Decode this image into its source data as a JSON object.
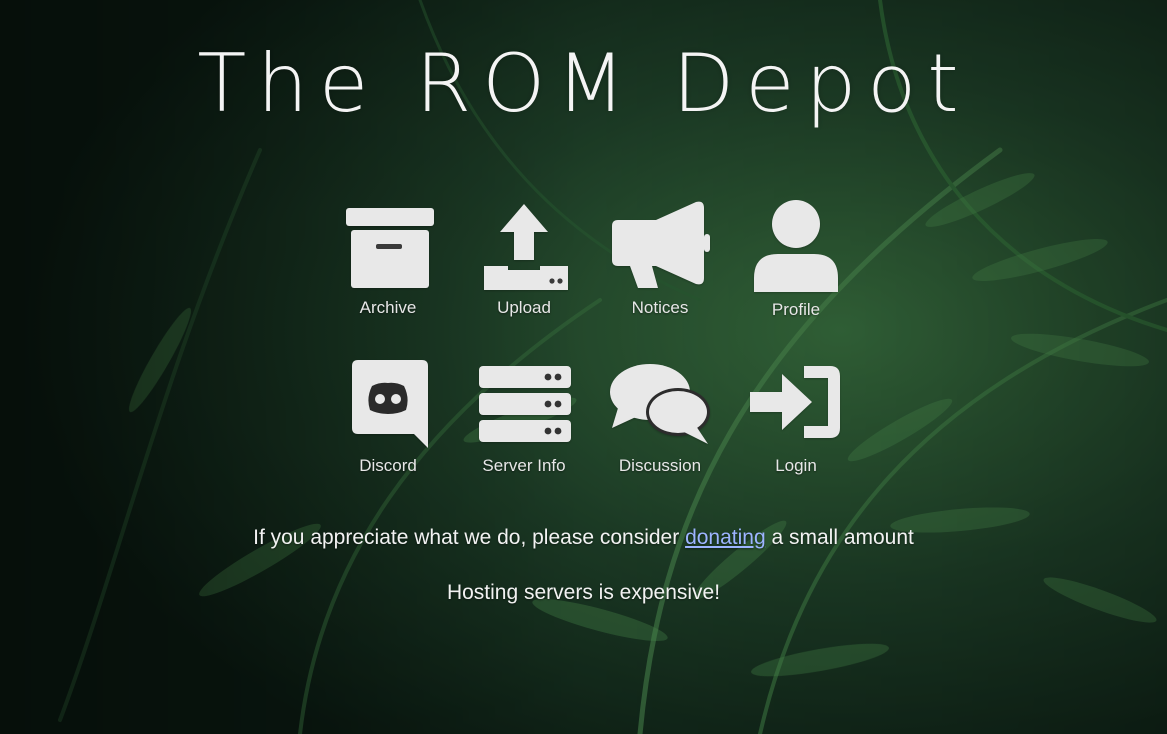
{
  "site": {
    "title": "The ROM Depot"
  },
  "nav": [
    {
      "label": "Archive",
      "icon": "archive-icon"
    },
    {
      "label": "Upload",
      "icon": "upload-icon"
    },
    {
      "label": "Notices",
      "icon": "megaphone-icon"
    },
    {
      "label": "Profile",
      "icon": "user-icon"
    },
    {
      "label": "Discord",
      "icon": "discord-icon"
    },
    {
      "label": "Server Info",
      "icon": "server-icon"
    },
    {
      "label": "Discussion",
      "icon": "chat-bubbles-icon"
    },
    {
      "label": "Login",
      "icon": "sign-in-icon"
    }
  ],
  "donate": {
    "before": "If you appreciate what we do, please consider ",
    "link": "donating",
    "after": " a small amount"
  },
  "note": "Hosting servers is expensive!",
  "colors": {
    "icon": "#e8e8e8",
    "link": "#9db4ff",
    "background": "#173322"
  }
}
